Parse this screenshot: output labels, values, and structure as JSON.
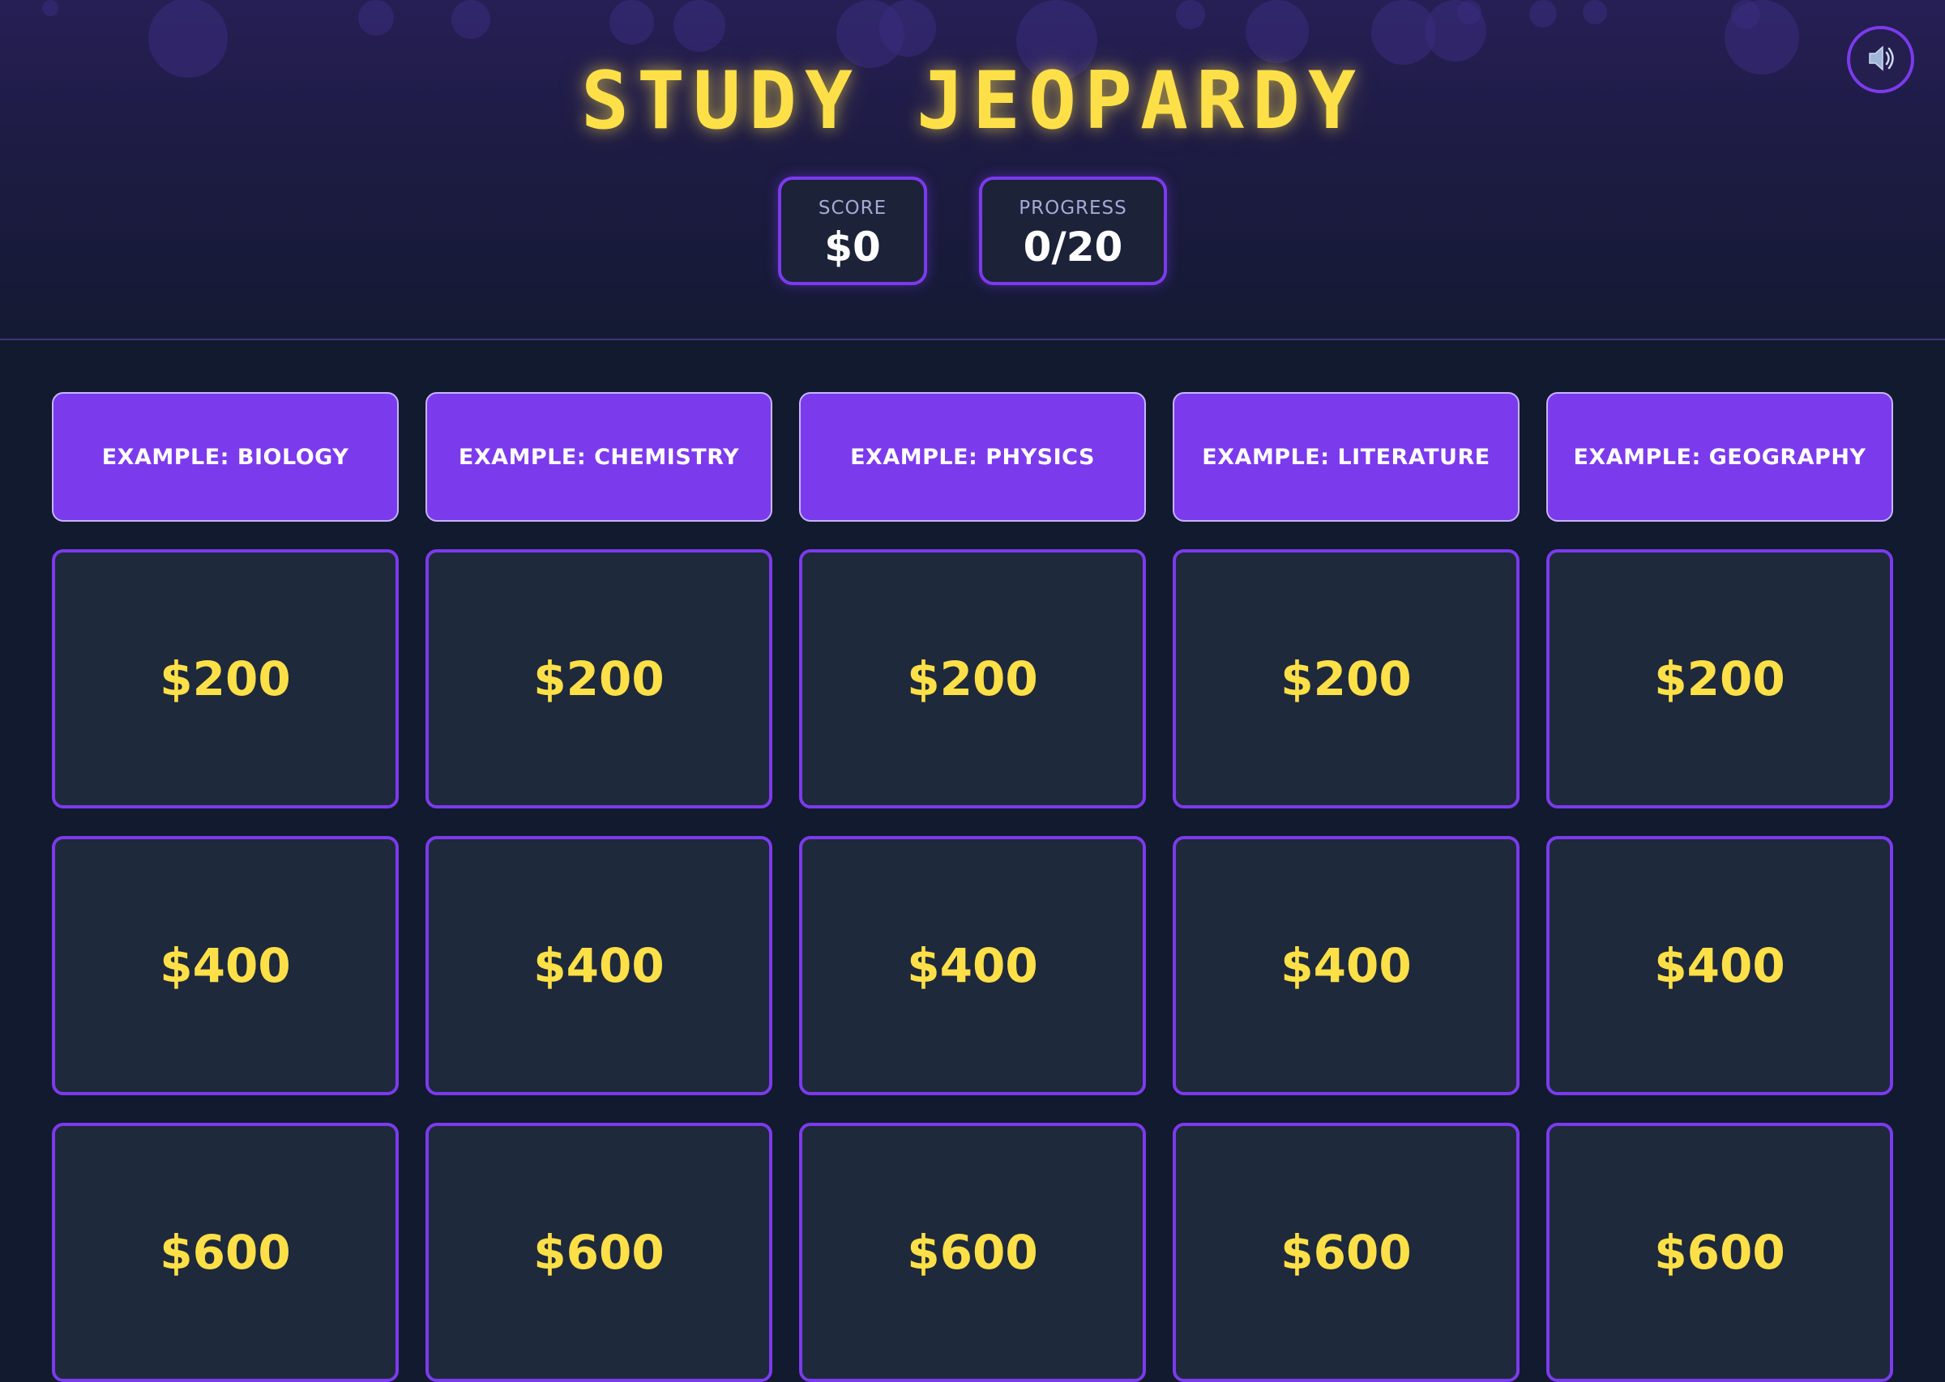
{
  "header": {
    "title": "STUDY JEOPARDY",
    "sound_icon": "speaker-icon"
  },
  "stats": {
    "score_label": "SCORE",
    "score_value": "$0",
    "progress_label": "PROGRESS",
    "progress_value": "0/20"
  },
  "categories": [
    "EXAMPLE: BIOLOGY",
    "EXAMPLE: CHEMISTRY",
    "EXAMPLE: PHYSICS",
    "EXAMPLE: LITERATURE",
    "EXAMPLE: GEOGRAPHY"
  ],
  "values": [
    "$200",
    "$400",
    "$600"
  ],
  "colors": {
    "accent": "#7c3aed",
    "title": "#fde047",
    "tile_bg": "#1e293b",
    "page_bg": "#111a2e"
  }
}
